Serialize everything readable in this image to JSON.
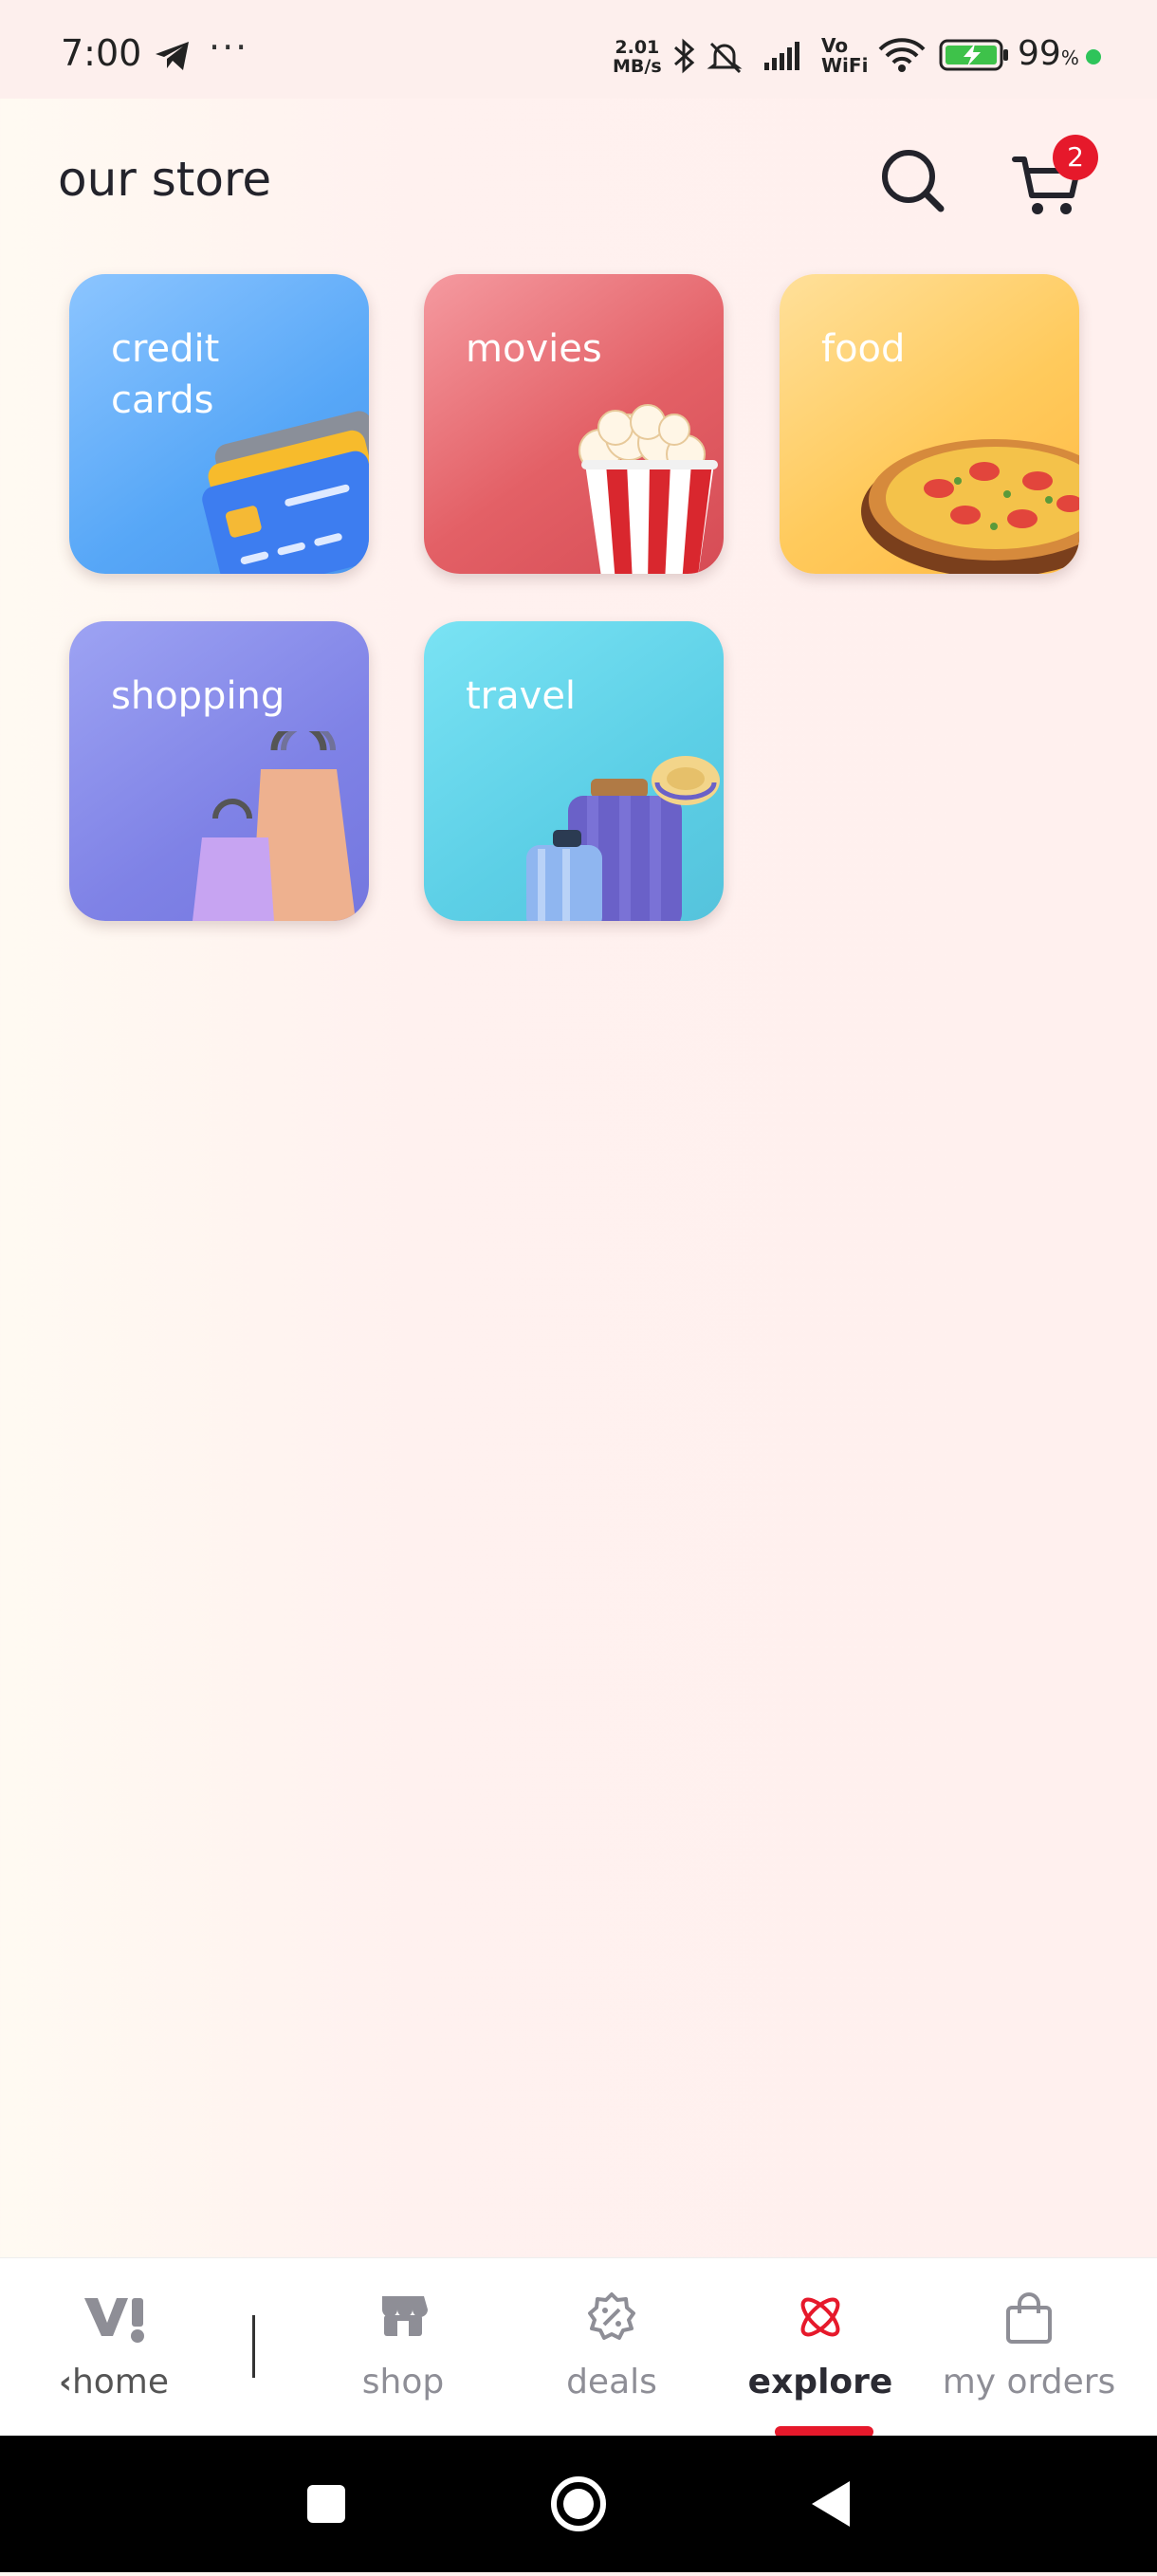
{
  "status_bar": {
    "time": "7:00",
    "telegram_icon": "telegram-icon",
    "more": "···",
    "speed_value": "2.01",
    "speed_unit": "MB/s",
    "vowifi_top": "Vo",
    "vowifi_bottom": "WiFi",
    "battery_percent": "99",
    "battery_percent_sign": "%"
  },
  "header": {
    "title": "our store",
    "search_icon": "search-icon",
    "cart_icon": "cart-icon",
    "cart_count": "2"
  },
  "categories": [
    {
      "label": "credit\ncards",
      "icon": "credit-card-icon"
    },
    {
      "label": "movies",
      "icon": "popcorn-icon"
    },
    {
      "label": "food",
      "icon": "pizza-icon"
    },
    {
      "label": "shopping",
      "icon": "shopping-bags-icon"
    },
    {
      "label": "travel",
      "icon": "luggage-icon"
    }
  ],
  "bottom_nav": {
    "home": "home",
    "shop": "shop",
    "deals": "deals",
    "explore": "explore",
    "my_orders": "my orders",
    "active": "explore",
    "accent_color": "#e6192b"
  },
  "colors": {
    "badge": "#e6192b",
    "online_dot": "#2ec45a"
  }
}
